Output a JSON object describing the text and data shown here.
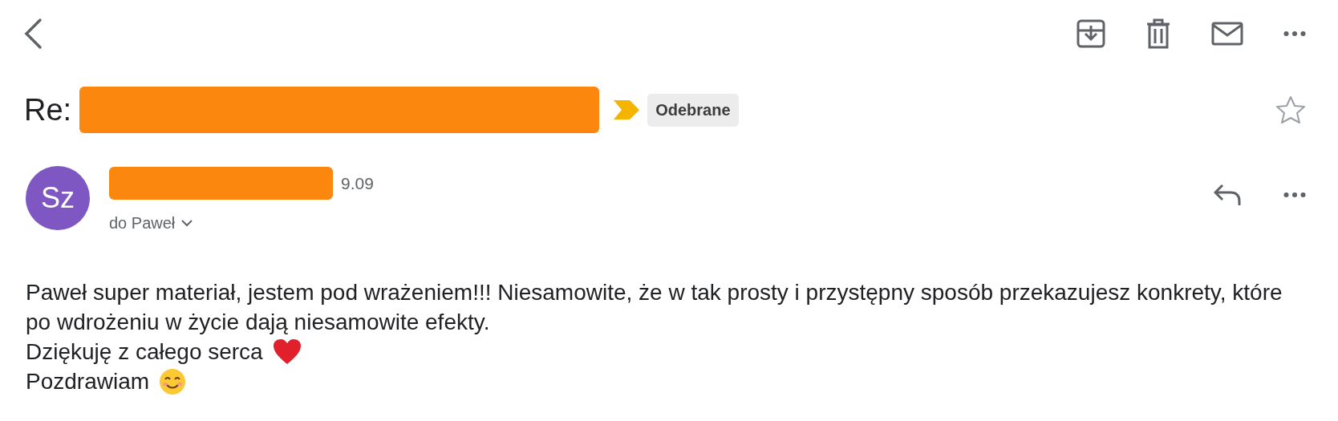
{
  "subject": {
    "prefix": "Re:",
    "label": "Odebrane",
    "starred": false
  },
  "message": {
    "initials": "Sz",
    "time": "9.09",
    "recipient": "do Paweł",
    "body": [
      {
        "kind": "text",
        "text": "Paweł super materiał, jestem pod wrażeniem!!! Niesamowite, że w tak prosty i przystępny sposób przekazujesz konkrety, które po wdrożeniu w życie dają niesamowite efekty."
      },
      {
        "kind": "heart",
        "text": "Dziękuję z całego serca"
      },
      {
        "kind": "smile",
        "text": "Pozdrawiam"
      }
    ]
  }
}
